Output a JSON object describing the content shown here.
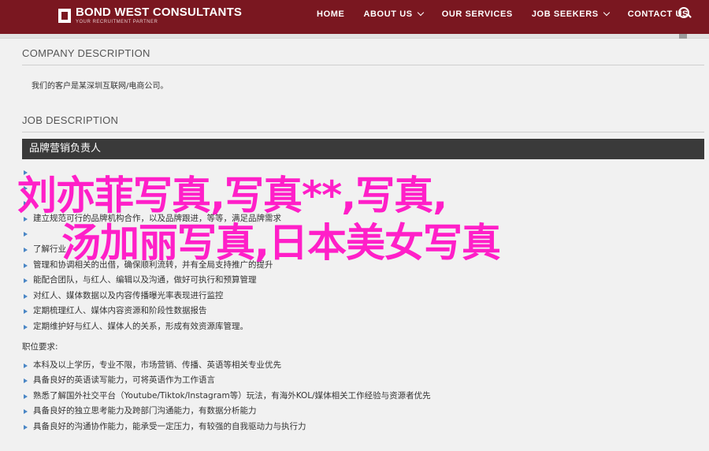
{
  "header": {
    "logo_title": "BOND WEST CONSULTANTS",
    "logo_subtitle": "YOUR RECRUITMENT PARTNER",
    "nav": [
      {
        "label": "HOME",
        "has_dropdown": false
      },
      {
        "label": "ABOUT US",
        "has_dropdown": true
      },
      {
        "label": "OUR SERVICES",
        "has_dropdown": false
      },
      {
        "label": "JOB SEEKERS",
        "has_dropdown": true
      },
      {
        "label": "CONTACT US",
        "has_dropdown": false
      }
    ],
    "search_icon": "search-icon",
    "bar_color": "#7a1720"
  },
  "company": {
    "title": "COMPANY DESCRIPTION",
    "text": "我们的客户是某深圳互联网/电商公司。"
  },
  "job": {
    "title": "JOB DESCRIPTION",
    "position": "品牌营销负责人",
    "duties": [
      "",
      "",
      "",
      "建立规范可行的品牌机构合作，以及品牌跟进，等等，满足品牌需求",
      "",
      "了解行业",
      "管理和协调相关的出借，确保顺利流转，并有全局支持推广的提升",
      "能配合团队，与红人、编辑以及沟通，做好可执行和预算管理",
      "对红人、媒体数据以及内容传播曝光率表现进行监控",
      "定期梳理红人、媒体内容资源和阶段性数据报告",
      "定期维护好与红人、媒体人的关系，形成有效资源库管理。"
    ],
    "requirements_heading": "职位要求:",
    "requirements": [
      "本科及以上学历，专业不限，市场营销、传播、英语等相关专业优先",
      "具备良好的英语读写能力，可将英语作为工作语言",
      "熟悉了解国外社交平台（Youtube/Tiktok/Instagram等）玩法，有海外KOL/媒体相关工作经验与资源者优先",
      "具备良好的独立思考能力及跨部门沟通能力，有数据分析能力",
      "具备良好的沟通协作能力，能承受一定压力，有较强的自我驱动力与执行力"
    ]
  },
  "overlay": {
    "line1": "刘亦菲写真,写真**,写真,",
    "line2": "汤加丽写真,日本美女写真",
    "color": "#ff1fc8"
  }
}
